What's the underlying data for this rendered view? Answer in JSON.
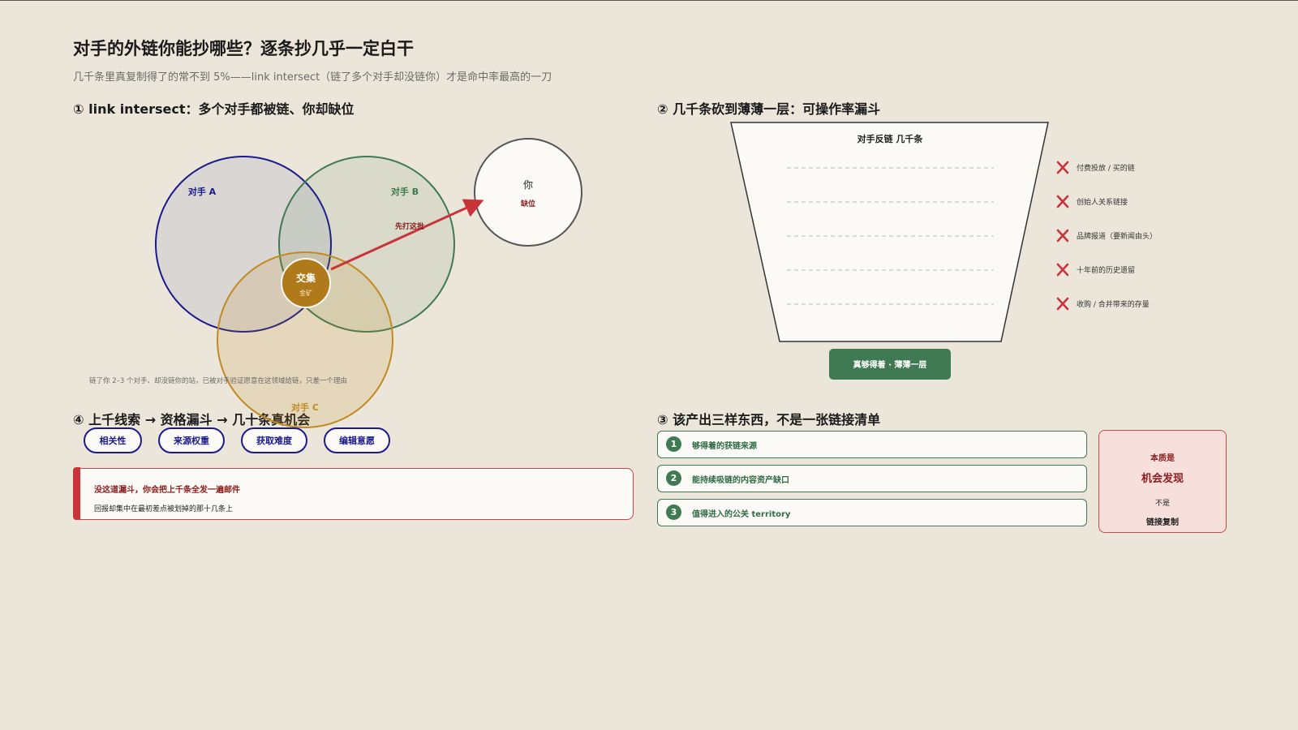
{
  "title": "对手的外链你能抄哪些？逐条抄几乎一定白干",
  "subtitle": "几千条里真复制得了的常不到 5%——link intersect（链了多个对手却没链你）才是命中率最高的一刀",
  "section1": {
    "title": "① link intersect：多个对手都被链、你却缺位",
    "competitor_a": "对手 A",
    "competitor_b": "对手 B",
    "competitor_c": "对手 C",
    "intersection_label": "交集",
    "intersection_sub": "金矿",
    "you_label": "你",
    "you_sub": "缺位",
    "arrow_label": "先打这批",
    "note": "链了你 2–3 个对手、却没链你的站，已被对手验证愿意在这领域给链，只差一个理由",
    "colors": {
      "a": "#1a1a8c",
      "b": "#3f7a52",
      "c": "#c28a22",
      "accent": "#c9343b"
    }
  },
  "section2": {
    "title": "② 几千条砍到薄薄一层：可操作率漏斗",
    "funnel_title": "对手反链 几千条",
    "removals": [
      "付费投放 / 买的链",
      "创始人关系链接",
      "品牌报道（要新闻由头）",
      "十年前的历史遗留",
      "收购 / 合并带来的存量"
    ],
    "result_label": "真够得着 · 薄薄一层"
  },
  "section3": {
    "title": "③ 该产出三样东西，不是一张链接清单",
    "outputs": [
      {
        "num": "1",
        "label": "够得着的获链来源"
      },
      {
        "num": "2",
        "label": "能持续吸链的内容资产缺口"
      },
      {
        "num": "3",
        "label": "值得进入的公关 territory"
      }
    ],
    "essence": {
      "line1": "本质是",
      "line2": "机会发现",
      "line3": "不是",
      "line4": "链接复制"
    }
  },
  "section4": {
    "title": "④ 上千线索 → 资格漏斗 → 几十条真机会",
    "criteria": [
      "相关性",
      "来源权重",
      "获取难度",
      "编辑意愿"
    ],
    "warning_title": "没这道漏斗，你会把上千条全发一遍邮件",
    "warning_body": "回报却集中在最初差点被划掉的那十几条上"
  }
}
